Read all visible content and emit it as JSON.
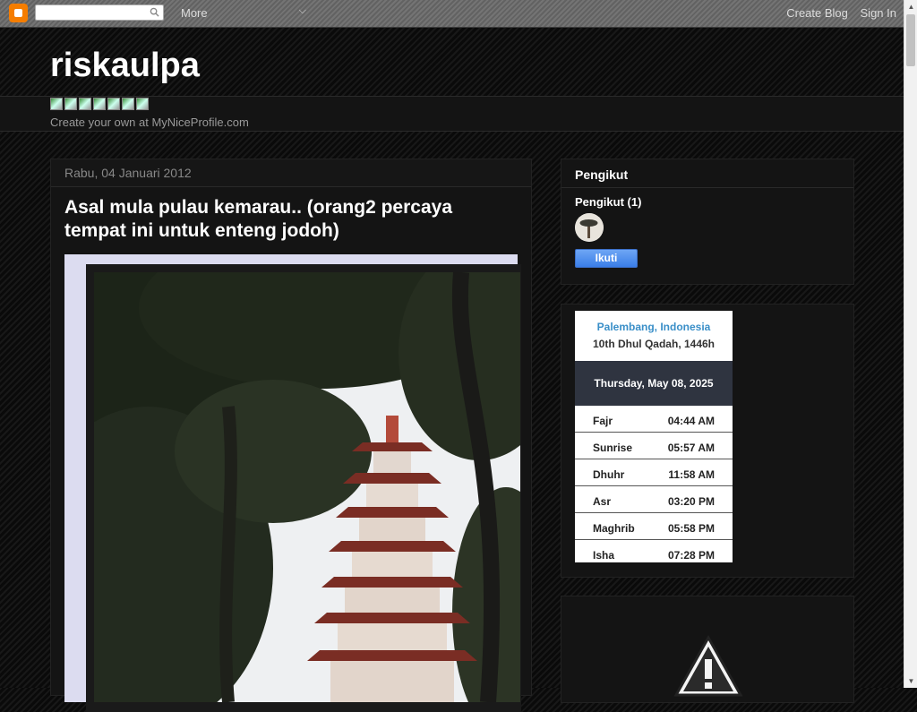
{
  "navbar": {
    "search_placeholder": "",
    "more_label": "More",
    "create_blog": "Create Blog",
    "sign_in": "Sign In"
  },
  "header": {
    "title": "riskaulpa",
    "badge_link": "Create your own at MyNiceProfile.com"
  },
  "post": {
    "date": "Rabu, 04 Januari 2012",
    "title": "Asal mula pulau kemarau.. (orang2 percaya tempat ini untuk enteng jodoh)"
  },
  "followers": {
    "title": "Pengikut",
    "count_label": "Pengikut (1)",
    "follow_button": "Ikuti"
  },
  "prayer": {
    "location": "Palembang, Indonesia",
    "hijri_date": "10th Dhul Qadah, 1446h",
    "date": "Thursday, May 08, 2025",
    "times": [
      {
        "name": "Fajr",
        "time": "04:44 AM"
      },
      {
        "name": "Sunrise",
        "time": "05:57 AM"
      },
      {
        "name": "Dhuhr",
        "time": "11:58 AM"
      },
      {
        "name": "Asr",
        "time": "03:20 PM"
      },
      {
        "name": "Maghrib",
        "time": "05:58 PM"
      },
      {
        "name": "Isha",
        "time": "07:28 PM"
      }
    ]
  },
  "colors": {
    "accent_orange": "#f57d00",
    "follow_blue": "#3a7ee8",
    "prayer_location": "#3a8fc8"
  }
}
